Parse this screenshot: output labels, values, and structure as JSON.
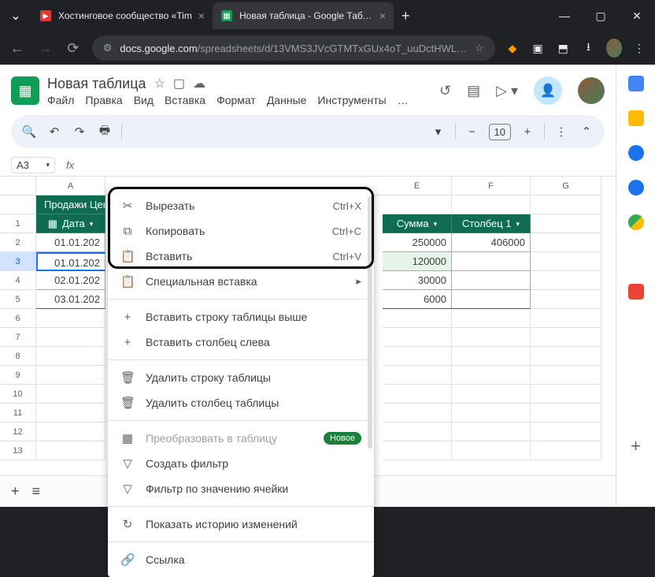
{
  "browser": {
    "tabs": [
      {
        "title": "Хостинговое сообщество «Tim",
        "favcolor": "red"
      },
      {
        "title": "Новая таблица - Google Табли",
        "favcolor": "green"
      }
    ],
    "url_host": "docs.google.com",
    "url_path": "/spreadsheets/d/13VMS3JVcGTMTxGUx4oT_uuDctHWL…"
  },
  "doc": {
    "title": "Новая таблица",
    "menus": [
      "Файл",
      "Правка",
      "Вид",
      "Вставка",
      "Формат",
      "Данные",
      "Инструменты",
      "…"
    ]
  },
  "toolbar": {
    "font_size": "10"
  },
  "namebox": "A3",
  "columns": [
    "A",
    "E",
    "F",
    "G"
  ],
  "table_title": "Продажи Цен",
  "headers": {
    "date": "Дата",
    "sum": "Сумма",
    "col1": "Столбец 1"
  },
  "rows": [
    {
      "n": "1",
      "date": ""
    },
    {
      "n": "2",
      "date": "01.01.202",
      "sum": "250000",
      "col1": "406000"
    },
    {
      "n": "3",
      "date": "01.01.202",
      "sum": "120000",
      "col1": ""
    },
    {
      "n": "4",
      "date": "02.01.202",
      "sum": "30000",
      "col1": ""
    },
    {
      "n": "5",
      "date": "03.01.202",
      "sum": "6000",
      "col1": ""
    },
    {
      "n": "6"
    },
    {
      "n": "7"
    },
    {
      "n": "8"
    },
    {
      "n": "9"
    },
    {
      "n": "10"
    },
    {
      "n": "11"
    },
    {
      "n": "12"
    },
    {
      "n": "13"
    }
  ],
  "ctx": {
    "cut": "Вырезать",
    "cut_k": "Ctrl+X",
    "copy": "Копировать",
    "copy_k": "Ctrl+C",
    "paste": "Вставить",
    "paste_k": "Ctrl+V",
    "pspecial": "Специальная вставка",
    "irow": "Вставить строку таблицы выше",
    "icol": "Вставить столбец слева",
    "drow": "Удалить строку таблицы",
    "dcol": "Удалить столбец таблицы",
    "totable": "Преобразовать в таблицу",
    "totable_badge": "Новое",
    "filter": "Создать фильтр",
    "filterval": "Фильтр по значению ячейки",
    "history": "Показать историю изменений",
    "link": "Ссылка"
  }
}
